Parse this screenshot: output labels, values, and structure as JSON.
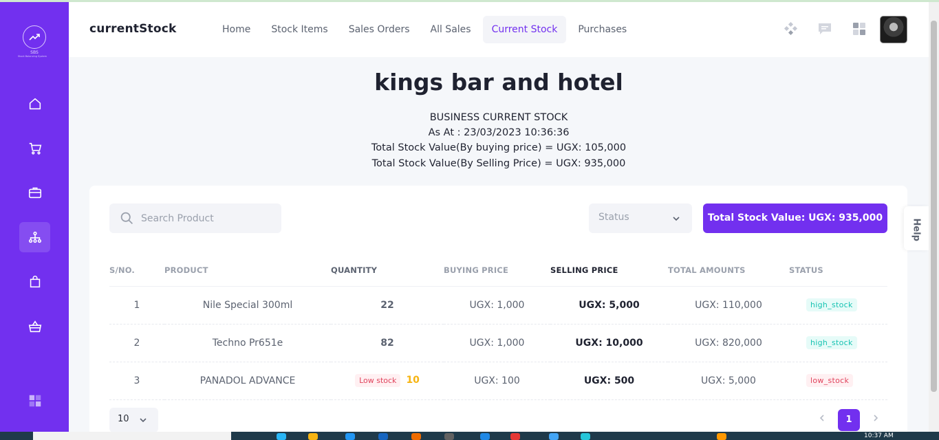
{
  "sidebar": {
    "logo_text": "SBS",
    "logo_sub": "Stock Balancing System",
    "items": [
      {
        "icon": "home-icon"
      },
      {
        "icon": "cart-icon"
      },
      {
        "icon": "briefcase-icon"
      },
      {
        "icon": "hierarchy-icon",
        "active": true
      },
      {
        "icon": "bag-icon"
      },
      {
        "icon": "basket-icon"
      },
      {
        "icon": "apps-icon"
      }
    ]
  },
  "header": {
    "title": "currentStock",
    "menu": [
      "Home",
      "Stock Items",
      "Sales Orders",
      "All Sales",
      "Current Stock",
      "Purchases"
    ],
    "active_menu": "Current Stock"
  },
  "report": {
    "business_name": "kings bar and hotel",
    "heading": "BUSINESS CURRENT STOCK",
    "as_at": "As At : 23/03/2023 10:36:36",
    "buying_total": "Total Stock Value(By buying price) = UGX: 105,000",
    "selling_total": "Total Stock Value(By Selling Price) = UGX: 935,000"
  },
  "toolbar": {
    "search_placeholder": "Search Product",
    "status_placeholder": "Status",
    "total_button": "Total Stock Value: UGX: 935,000"
  },
  "table": {
    "headers": [
      "S/NO.",
      "PRODUCT",
      "QUANTITY",
      "BUYING PRICE",
      "SELLING PRICE",
      "TOTAL AMOUNTS",
      "STATUS"
    ],
    "rows": [
      {
        "sn": "1",
        "product": "Nile Special 300ml",
        "qty": "22",
        "buying": "UGX: 1,000",
        "selling": "UGX: 5,000",
        "total": "UGX: 110,000",
        "status": "high_stock"
      },
      {
        "sn": "2",
        "product": "Techno Pr651e",
        "qty": "82",
        "buying": "UGX: 1,000",
        "selling": "UGX: 10,000",
        "total": "UGX: 820,000",
        "status": "high_stock"
      },
      {
        "sn": "3",
        "product": "PANADOL ADVANCE",
        "qty_badge": "Low stock",
        "qty": "10",
        "buying": "UGX: 100",
        "selling": "UGX: 500",
        "total": "UGX: 5,000",
        "status": "low_stock"
      }
    ]
  },
  "pagination": {
    "page_size": "10",
    "current_page": "1"
  },
  "help": "Help",
  "taskbar": {
    "time": "10:37 AM"
  },
  "colors": {
    "primary": "#7230ef",
    "high_stock": "#17c3b2",
    "low_stock": "#e0435c",
    "warning": "#f6b412"
  }
}
